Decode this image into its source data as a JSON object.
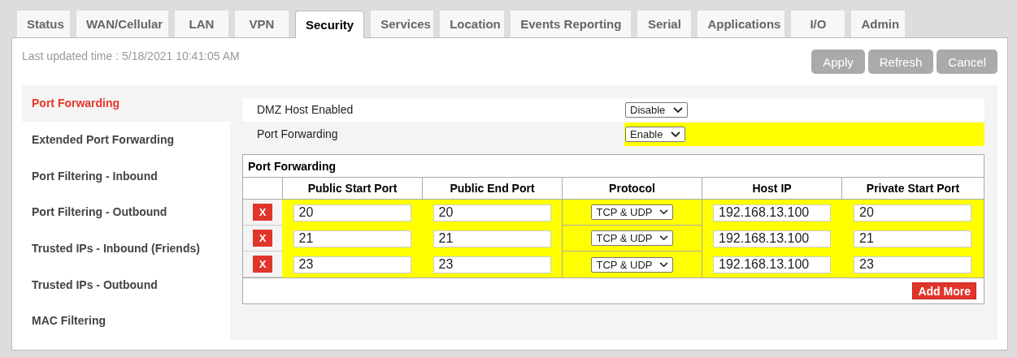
{
  "tabs": [
    {
      "label": "Status",
      "selected": false
    },
    {
      "label": "WAN/Cellular",
      "selected": false
    },
    {
      "label": "LAN",
      "selected": false
    },
    {
      "label": "VPN",
      "selected": false
    },
    {
      "label": "Security",
      "selected": true
    },
    {
      "label": "Services",
      "selected": false
    },
    {
      "label": "Location",
      "selected": false
    },
    {
      "label": "Events Reporting",
      "selected": false
    },
    {
      "label": "Serial",
      "selected": false
    },
    {
      "label": "Applications",
      "selected": false
    },
    {
      "label": "I/O",
      "selected": false
    },
    {
      "label": "Admin",
      "selected": false
    }
  ],
  "last_updated": "Last updated time : 5/18/2021 10:41:05 AM",
  "buttons": [
    "Apply",
    "Refresh",
    "Cancel"
  ],
  "sidebar": {
    "items": [
      {
        "label": "Port Forwarding",
        "selected": true
      },
      {
        "label": "Extended Port Forwarding",
        "selected": false
      },
      {
        "label": "Port Filtering - Inbound",
        "selected": false
      },
      {
        "label": "Port Filtering - Outbound",
        "selected": false
      },
      {
        "label": "Trusted IPs - Inbound (Friends)",
        "selected": false
      },
      {
        "label": "Trusted IPs - Outbound",
        "selected": false
      },
      {
        "label": "MAC Filtering",
        "selected": false
      }
    ]
  },
  "settings": [
    {
      "label": "DMZ Host Enabled",
      "value": "Disable",
      "highlighted": false
    },
    {
      "label": "Port Forwarding",
      "value": "Enable",
      "highlighted": true
    }
  ],
  "table": {
    "title": "Port Forwarding",
    "columns": [
      "Public Start Port",
      "Public End Port",
      "Protocol",
      "Host IP",
      "Private Start Port"
    ],
    "rows": [
      {
        "delete": "X",
        "public_start": "20",
        "public_end": "20",
        "protocol": "TCP & UDP",
        "host_ip": "192.168.13.100",
        "private_start": "20",
        "highlighted": true
      },
      {
        "delete": "X",
        "public_start": "21",
        "public_end": "21",
        "protocol": "TCP & UDP",
        "host_ip": "192.168.13.100",
        "private_start": "21",
        "highlighted": true
      },
      {
        "delete": "X",
        "public_start": "23",
        "public_end": "23",
        "protocol": "TCP & UDP",
        "host_ip": "192.168.13.100",
        "private_start": "23",
        "highlighted": true
      }
    ],
    "add_button": "Add More"
  }
}
